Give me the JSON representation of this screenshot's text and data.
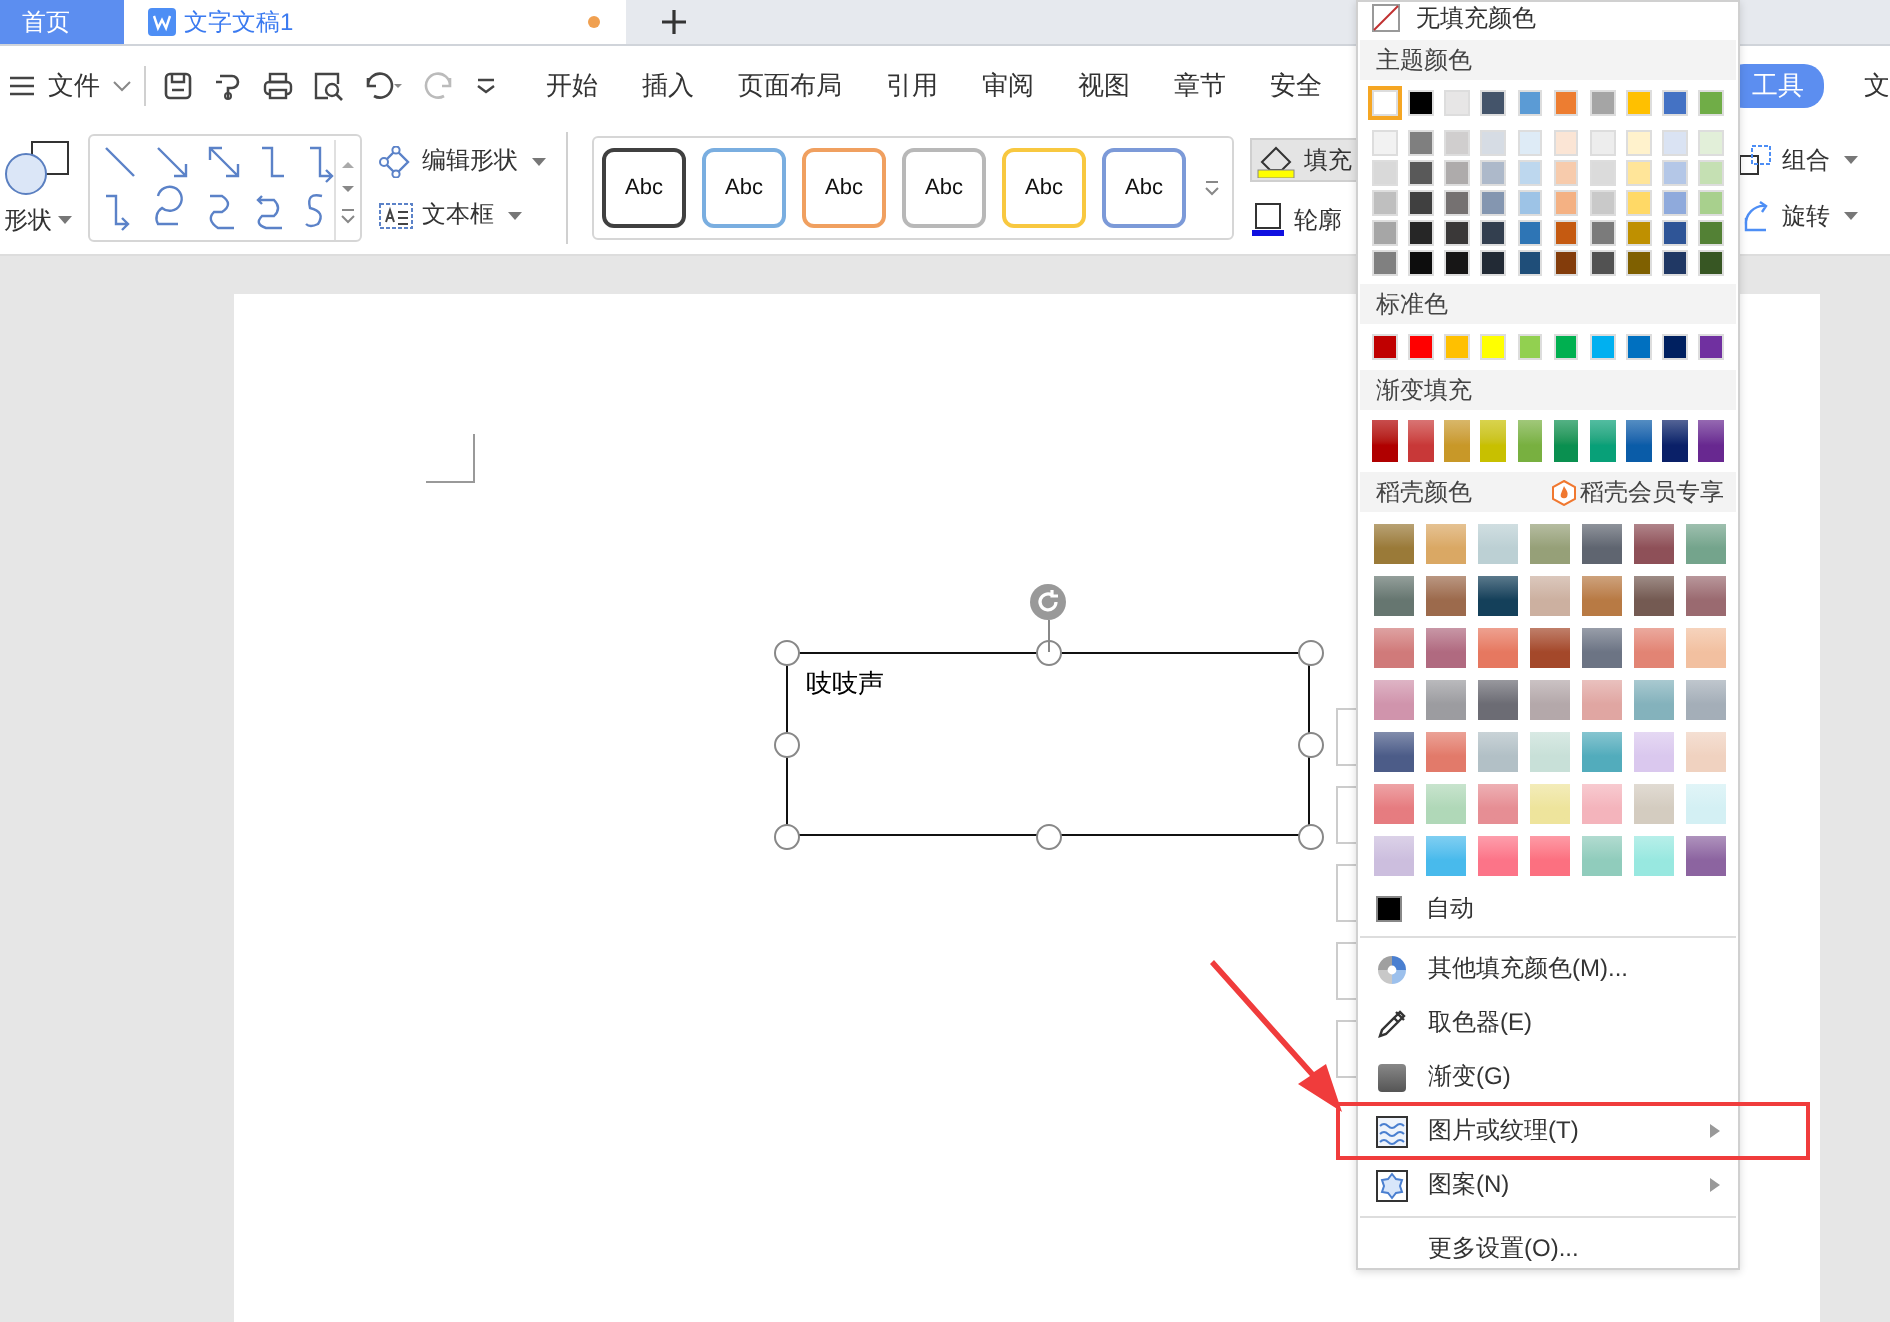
{
  "tabs": [
    {
      "label": "首页",
      "selected": true
    },
    {
      "label": "文字文稿1",
      "selected": false,
      "unsaved": true
    }
  ],
  "menu": {
    "file": "文件",
    "tabs": [
      "开始",
      "插入",
      "页面布局",
      "引用",
      "审阅",
      "视图",
      "章节",
      "安全"
    ],
    "context_tab": "工具",
    "cut_tab": "文"
  },
  "ribbon": {
    "shape": "形状",
    "edit_shape": "编辑形状",
    "text_box": "文本框",
    "styles": [
      {
        "label": "Abc",
        "color": "#404040"
      },
      {
        "label": "Abc",
        "color": "#7aaee0"
      },
      {
        "label": "Abc",
        "color": "#f0a060"
      },
      {
        "label": "Abc",
        "color": "#b8b8b8"
      },
      {
        "label": "Abc",
        "color": "#f8c840"
      },
      {
        "label": "Abc",
        "color": "#7c9ad8"
      }
    ],
    "fill": "填充",
    "outline": "轮廓",
    "group": "组合",
    "rotate": "旋转"
  },
  "document": {
    "shape_text": "吱吱声"
  },
  "fill_menu": {
    "no_fill": "无填充颜色",
    "theme_header": "主题颜色",
    "theme": [
      {
        "color": "#ffffff",
        "selected": true
      },
      {
        "color": "#000000",
        "selected": false
      },
      {
        "color": "#e7e6e6",
        "selected": false
      },
      {
        "color": "#44546a",
        "selected": false
      },
      {
        "color": "#5b9bd5",
        "selected": false
      },
      {
        "color": "#ed7d31",
        "selected": false
      },
      {
        "color": "#a5a5a5",
        "selected": false
      },
      {
        "color": "#ffc000",
        "selected": false
      },
      {
        "color": "#4472c4",
        "selected": false
      },
      {
        "color": "#70ad47",
        "selected": false
      }
    ],
    "shades": [
      [
        {
          "color": "#f2f2f2"
        },
        {
          "color": "#7f7f7f"
        },
        {
          "color": "#d0cece"
        },
        {
          "color": "#d6dce4"
        },
        {
          "color": "#deebf6"
        },
        {
          "color": "#fbe5d5"
        },
        {
          "color": "#ededed"
        },
        {
          "color": "#fff2cc"
        },
        {
          "color": "#dae3f3"
        },
        {
          "color": "#e2efd9"
        }
      ],
      [
        {
          "color": "#d9d9d9"
        },
        {
          "color": "#595959"
        },
        {
          "color": "#aeabab"
        },
        {
          "color": "#adb9ca"
        },
        {
          "color": "#bdd7ee"
        },
        {
          "color": "#f7cbac"
        },
        {
          "color": "#dbdbdb"
        },
        {
          "color": "#ffe599"
        },
        {
          "color": "#b4c7e7"
        },
        {
          "color": "#c5e0b3"
        }
      ],
      [
        {
          "color": "#bfbfbf"
        },
        {
          "color": "#404040"
        },
        {
          "color": "#757171"
        },
        {
          "color": "#8496b0"
        },
        {
          "color": "#9dc3e6"
        },
        {
          "color": "#f4b183"
        },
        {
          "color": "#c9c9c9"
        },
        {
          "color": "#ffd966"
        },
        {
          "color": "#8faadc"
        },
        {
          "color": "#a8d08d"
        }
      ],
      [
        {
          "color": "#a6a6a6"
        },
        {
          "color": "#262626"
        },
        {
          "color": "#3a3838"
        },
        {
          "color": "#333f4f"
        },
        {
          "color": "#2e75b5"
        },
        {
          "color": "#c55a11"
        },
        {
          "color": "#7b7b7b"
        },
        {
          "color": "#bf9000"
        },
        {
          "color": "#2f5597"
        },
        {
          "color": "#538135"
        }
      ],
      [
        {
          "color": "#808080"
        },
        {
          "color": "#0d0d0d"
        },
        {
          "color": "#171616"
        },
        {
          "color": "#222a35"
        },
        {
          "color": "#1f4e79"
        },
        {
          "color": "#833c0b"
        },
        {
          "color": "#525252"
        },
        {
          "color": "#7f6000"
        },
        {
          "color": "#203864"
        },
        {
          "color": "#375623"
        }
      ]
    ],
    "standard_header": "标准色",
    "standard": [
      {
        "color": "#c00000"
      },
      {
        "color": "#ff0000"
      },
      {
        "color": "#ffc000"
      },
      {
        "color": "#ffff00"
      },
      {
        "color": "#92d050"
      },
      {
        "color": "#00b050"
      },
      {
        "color": "#00b0f0"
      },
      {
        "color": "#0070c0"
      },
      {
        "color": "#002060"
      },
      {
        "color": "#7030a0"
      }
    ],
    "gradient_header": "渐变填充",
    "gradients": [
      {
        "color": "#b00000"
      },
      {
        "color": "#c83838"
      },
      {
        "color": "#c89828"
      },
      {
        "color": "#c8c000"
      },
      {
        "color": "#78b040"
      },
      {
        "color": "#0a9050"
      },
      {
        "color": "#08a078"
      },
      {
        "color": "#0a5ca8"
      },
      {
        "color": "#0a2068"
      },
      {
        "color": "#682890"
      }
    ],
    "daoke_header": "稻壳颜色",
    "daoke_member": "稻壳会员专享",
    "daoke": [
      {
        "color": "#9a7a38"
      },
      {
        "color": "#daa864"
      },
      {
        "color": "#bcd0d4"
      },
      {
        "color": "#96a078"
      },
      {
        "color": "#5f6570"
      },
      {
        "color": "#8e5058"
      },
      {
        "color": "#74a48c"
      },
      {
        "color": "#667670"
      },
      {
        "color": "#9c6a4c"
      },
      {
        "color": "#14405a"
      },
      {
        "color": "#ccb0a0"
      },
      {
        "color": "#b87a44"
      },
      {
        "color": "#745a52"
      },
      {
        "color": "#9a6a70"
      },
      {
        "color": "#d07a7a"
      },
      {
        "color": "#b06a80"
      },
      {
        "color": "#e67860"
      },
      {
        "color": "#a4482a"
      },
      {
        "color": "#6c7484"
      },
      {
        "color": "#e28474"
      },
      {
        "color": "#f2c0a0"
      },
      {
        "color": "#d094ac"
      },
      {
        "color": "#9c9ca0"
      },
      {
        "color": "#6c6c74"
      },
      {
        "color": "#b4a8aa"
      },
      {
        "color": "#e0a6a2"
      },
      {
        "color": "#84b2bc"
      },
      {
        "color": "#a4aeb8"
      },
      {
        "color": "#4c5c88"
      },
      {
        "color": "#e27a6a"
      },
      {
        "color": "#b2c0c6"
      },
      {
        "color": "#c8e0d8"
      },
      {
        "color": "#52acbc"
      },
      {
        "color": "#dac8ee"
      },
      {
        "color": "#f0d2c0"
      },
      {
        "color": "#e67c80"
      },
      {
        "color": "#b0d8b8"
      },
      {
        "color": "#e68e94"
      },
      {
        "color": "#eee49c"
      },
      {
        "color": "#f4b4bc"
      },
      {
        "color": "#d4ccc0"
      },
      {
        "color": "#d4f0f4"
      },
      {
        "color": "#ccbede"
      },
      {
        "color": "#48baec"
      },
      {
        "color": "#fc7488"
      },
      {
        "color": "#fc7080"
      },
      {
        "color": "#90ccbc"
      },
      {
        "color": "#98e8e0"
      },
      {
        "color": "#8c64a0"
      }
    ],
    "auto": "自动",
    "items": [
      {
        "label": "其他填充颜色(M)...",
        "submenu": false,
        "highlighted": false
      },
      {
        "label": "取色器(E)",
        "submenu": false,
        "highlighted": false
      },
      {
        "label": "渐变(G)",
        "submenu": false,
        "highlighted": false
      },
      {
        "label": "图片或纹理(T)",
        "submenu": true,
        "highlighted": true
      },
      {
        "label": "图案(N)",
        "submenu": true,
        "highlighted": false
      }
    ],
    "more": "更多设置(O)..."
  },
  "pointer_arrow": true
}
